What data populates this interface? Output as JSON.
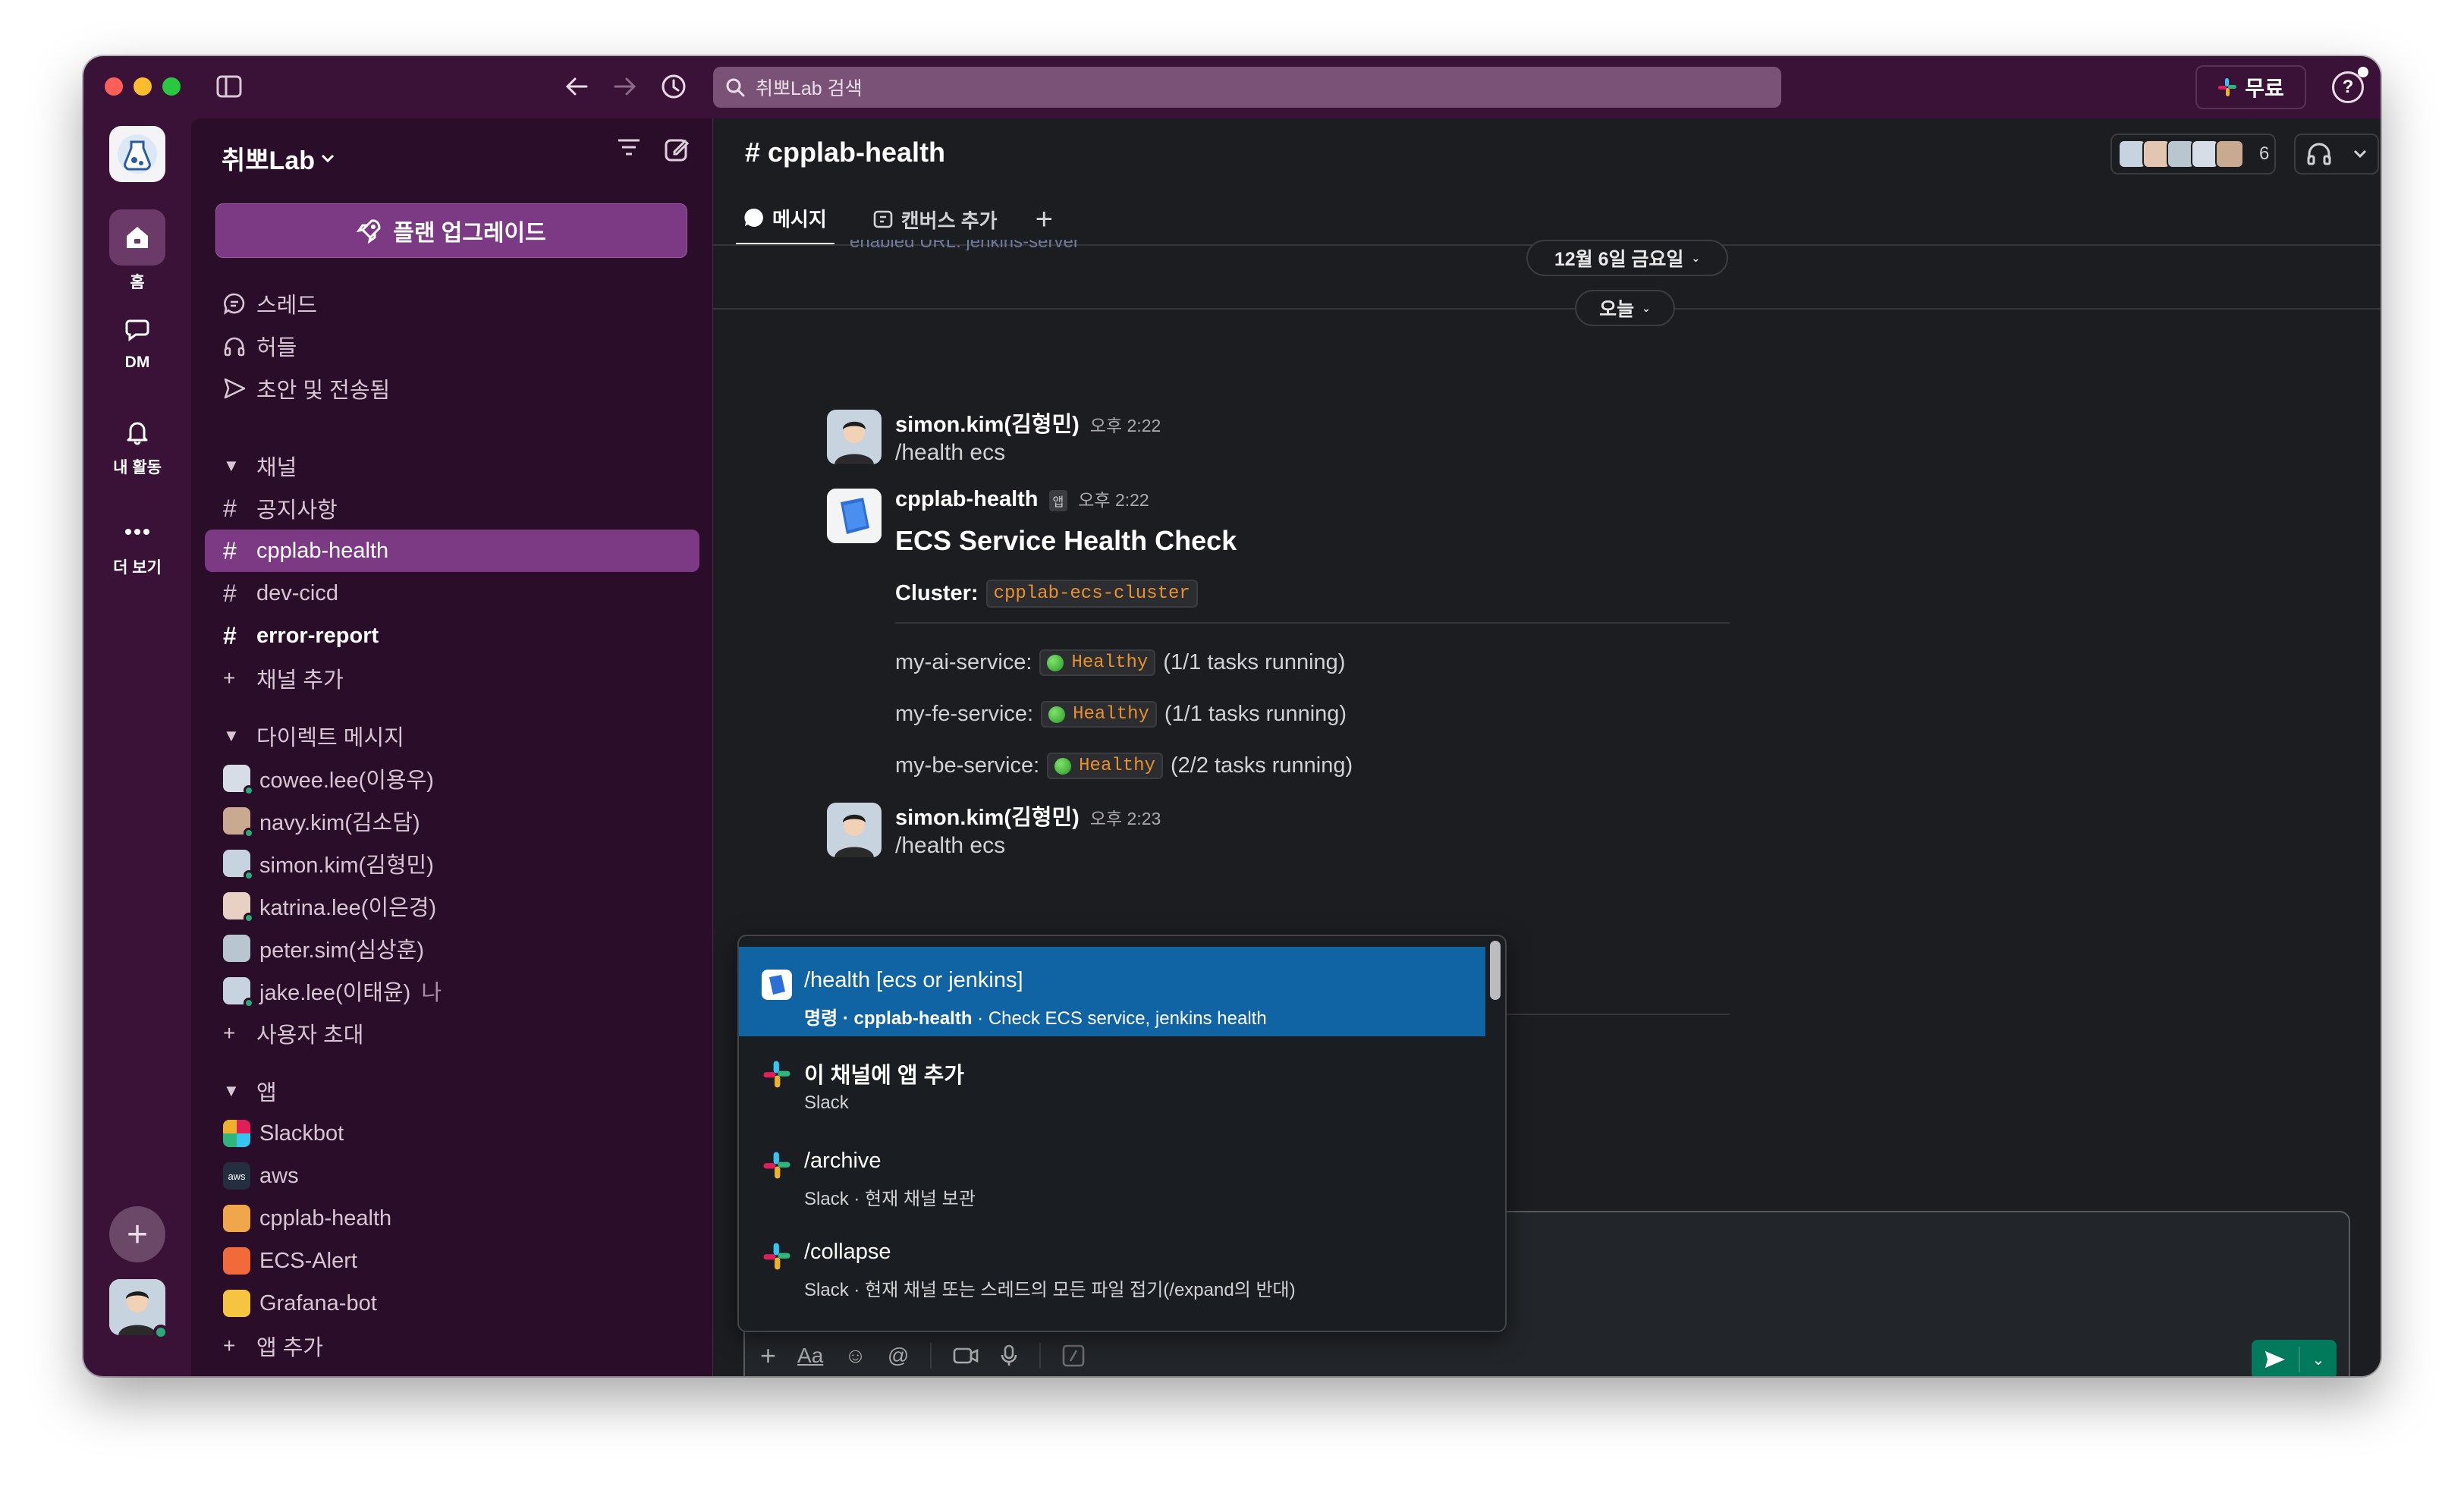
{
  "window": {
    "search_placeholder": "취뽀Lab 검색",
    "free_label": "무료",
    "help_label": "?"
  },
  "rail": {
    "items": [
      {
        "label": "홈",
        "icon": "home-icon"
      },
      {
        "label": "DM",
        "icon": "dm-icon"
      },
      {
        "label": "내 활동",
        "icon": "bell-icon"
      },
      {
        "label": "더 보기",
        "icon": "more-icon"
      }
    ]
  },
  "sidebar": {
    "workspace_name": "취뽀Lab",
    "upgrade_label": "플랜 업그레이드",
    "nav": [
      {
        "label": "스레드",
        "icon": "threads-icon"
      },
      {
        "label": "허들",
        "icon": "headphones-icon"
      },
      {
        "label": "초안 및 전송됨",
        "icon": "send-icon"
      }
    ],
    "channels_header": "채널",
    "channels": [
      {
        "name": "공지사항"
      },
      {
        "name": "cpplab-health"
      },
      {
        "name": "dev-cicd"
      },
      {
        "name": "error-report"
      }
    ],
    "add_channel": "채널 추가",
    "dm_header": "다이렉트 메시지",
    "dms": [
      {
        "name": "cowee.lee(이용우)"
      },
      {
        "name": "navy.kim(김소담)"
      },
      {
        "name": "simon.kim(김형민)"
      },
      {
        "name": "katrina.lee(이은경)"
      },
      {
        "name": "peter.sim(심상훈)"
      },
      {
        "name": "jake.lee(이태윤)",
        "suffix": "나"
      }
    ],
    "invite_label": "사용자 초대",
    "apps_header": "앱",
    "apps": [
      {
        "name": "Slackbot"
      },
      {
        "name": "aws"
      },
      {
        "name": "cpplab-health"
      },
      {
        "name": "ECS-Alert"
      },
      {
        "name": "Grafana-bot"
      }
    ],
    "add_app": "앱 추가"
  },
  "channel": {
    "title": "# cpplab-health",
    "member_count": "6",
    "tabs": [
      {
        "label": "메시지"
      },
      {
        "label": "캔버스 추가"
      }
    ],
    "date_prev": "12월 6일 금요일",
    "date_today": "오늘",
    "clipped_text": "enabled URL: jenkins-server"
  },
  "messages": [
    {
      "author": "simon.kim(김형민)",
      "time": "오후 2:22",
      "text": "/health ecs"
    },
    {
      "author": "cpplab-health",
      "badge": "앱",
      "time": "오후 2:22",
      "title": "ECS Service Health Check",
      "cluster_label": "Cluster:",
      "cluster": "cpplab-ecs-cluster",
      "services": [
        {
          "name": "my-ai-service:",
          "status": "Healthy",
          "detail": "(1/1 tasks running)"
        },
        {
          "name": "my-fe-service:",
          "status": "Healthy",
          "detail": "(1/1 tasks running)"
        },
        {
          "name": "my-be-service:",
          "status": "Healthy",
          "detail": "(2/2 tasks running)"
        }
      ]
    },
    {
      "author": "simon.kim(김형민)",
      "time": "오후 2:23",
      "text": "/health ecs"
    }
  ],
  "composer": {
    "value": "/"
  },
  "autocomplete": [
    {
      "title": "/health [ecs or jenkins]",
      "sub_bold": "명령 · cpplab-health",
      "sub": " · Check ECS service, jenkins health",
      "icon": "cpplab-app-icon"
    },
    {
      "title": "이 채널에 앱 추가",
      "sub_bold": "",
      "sub": "Slack",
      "icon": "slack-icon"
    },
    {
      "title": "/archive",
      "sub_bold": "",
      "sub": "Slack · 현재 채널 보관",
      "icon": "slack-icon"
    },
    {
      "title": "/collapse",
      "sub_bold": "",
      "sub": "Slack · 현재 채널 또는 스레드의 모든 파일 접기(/expand의 반대)",
      "icon": "slack-icon"
    }
  ],
  "colors": {
    "aubergine": "#3a1238",
    "sidebar": "#2a0d28",
    "active": "#7c3a85",
    "main_bg": "#1c1d21",
    "selection": "#1164a3",
    "code_text": "#e8912d",
    "send": "#007a5a"
  }
}
